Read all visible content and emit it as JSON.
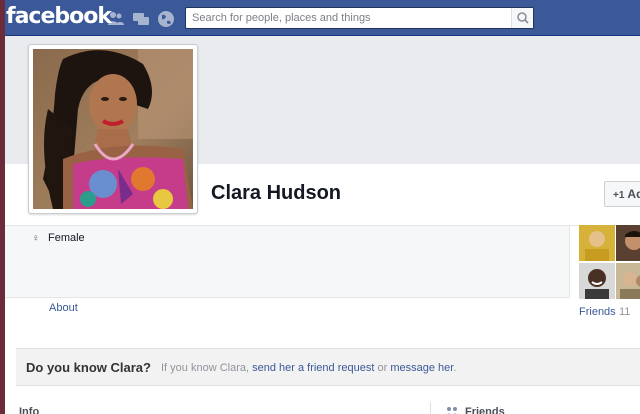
{
  "header": {
    "logo": "facebook",
    "search_placeholder": "Search for people, places and things"
  },
  "profile": {
    "name": "Clara Hudson",
    "add_friend_label": "Ad",
    "add_friend_icon": "+1"
  },
  "info_box": {
    "gender": "Female",
    "gender_icon": "♀"
  },
  "about_link": "About",
  "friends": {
    "label": "Friends",
    "count": "11"
  },
  "do_you_know": {
    "title": "Do you know Clara?",
    "text_prefix": "If you know Clara, ",
    "friend_request_link": "send her a friend request",
    "text_middle": " or ",
    "message_link": "message her",
    "text_suffix": "."
  },
  "sections": {
    "info": "Info",
    "friends": "Friends"
  },
  "colors": {
    "brand_blue": "#3b5998",
    "link_blue": "#3b5998"
  }
}
